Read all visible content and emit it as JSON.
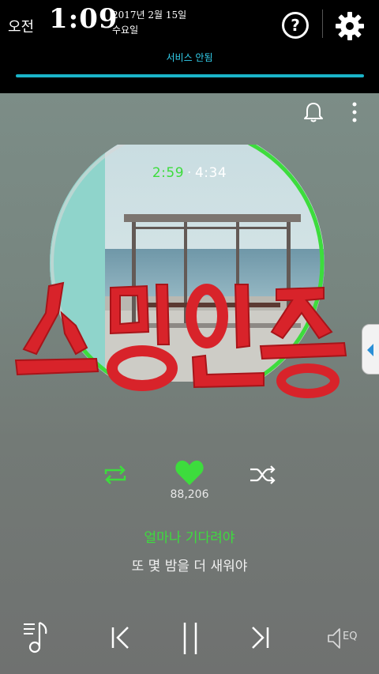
{
  "status": {
    "ampm": "오전",
    "time": "1:09",
    "date_line1": "2017년 2월 15일",
    "date_line2": "수요일",
    "help_label": "?",
    "service_label": "서비스 안됨"
  },
  "player": {
    "elapsed": "2:59",
    "separator": "·",
    "duration": "4:34",
    "progress_fraction": 0.654,
    "like_count": "88,206",
    "lyric_current": "얼마나 기다려야",
    "lyric_next": "또 몇 밤을 더 새워야",
    "watermark_text": "스밍인증",
    "eq_label": "EQ"
  },
  "colors": {
    "accent_green": "#3ddc3d",
    "service_cyan": "#33d0ee",
    "watermark_red": "#d8232a"
  },
  "icons": {
    "help": "help-icon",
    "settings": "gear-icon",
    "bell": "bell-icon",
    "more": "more-vertical-icon",
    "repeat": "repeat-icon",
    "like": "heart-icon",
    "shuffle": "shuffle-icon",
    "playlist": "playlist-icon",
    "prev": "previous-icon",
    "pause": "pause-icon",
    "next": "next-icon",
    "eq": "equalizer-icon",
    "side_tab": "arrow-left-icon"
  }
}
